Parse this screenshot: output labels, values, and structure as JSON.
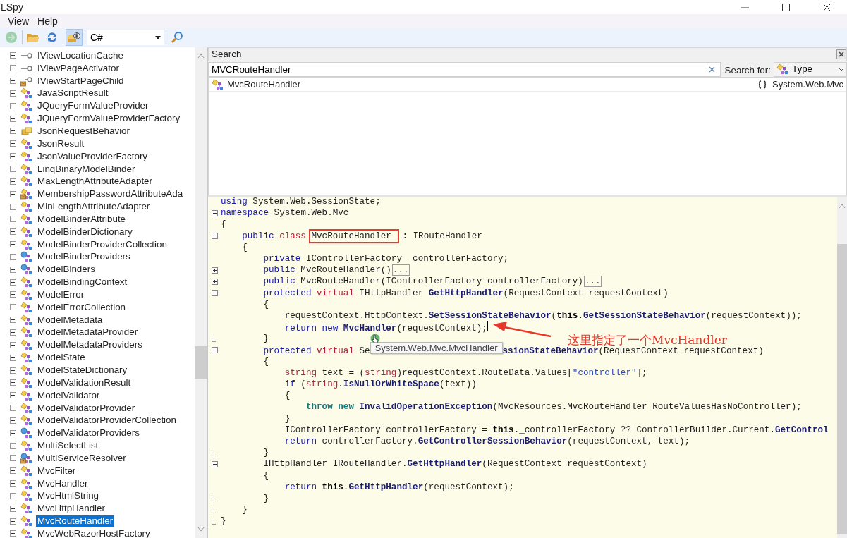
{
  "window": {
    "title": "LSpy"
  },
  "menu": [
    {
      "label": "View"
    },
    {
      "label": "Help"
    }
  ],
  "toolbar": {
    "back": {
      "disabled": true
    },
    "api_toggle": {
      "on": true
    },
    "language": "C#"
  },
  "tree": {
    "items": [
      {
        "label": "IViewLocationCache",
        "kind": "interface",
        "selected": false
      },
      {
        "label": "IViewPageActivator",
        "kind": "interface",
        "selected": false
      },
      {
        "label": "IViewStartPageChild",
        "kind": "interface-internal",
        "selected": false
      },
      {
        "label": "JavaScriptResult",
        "kind": "class",
        "selected": false
      },
      {
        "label": "JQueryFormValueProvider",
        "kind": "class",
        "selected": false
      },
      {
        "label": "JQueryFormValueProviderFactory",
        "kind": "class",
        "selected": false
      },
      {
        "label": "JsonRequestBehavior",
        "kind": "enum",
        "selected": false
      },
      {
        "label": "JsonResult",
        "kind": "class",
        "selected": false
      },
      {
        "label": "JsonValueProviderFactory",
        "kind": "class",
        "selected": false
      },
      {
        "label": "LinqBinaryModelBinder",
        "kind": "class",
        "selected": false
      },
      {
        "label": "MaxLengthAttributeAdapter",
        "kind": "class",
        "selected": false
      },
      {
        "label": "MembershipPasswordAttributeAda",
        "kind": "class-internal",
        "selected": false
      },
      {
        "label": "MinLengthAttributeAdapter",
        "kind": "class",
        "selected": false
      },
      {
        "label": "ModelBinderAttribute",
        "kind": "class",
        "selected": false
      },
      {
        "label": "ModelBinderDictionary",
        "kind": "class",
        "selected": false
      },
      {
        "label": "ModelBinderProviderCollection",
        "kind": "class",
        "selected": false
      },
      {
        "label": "ModelBinderProviders",
        "kind": "static-class",
        "selected": false
      },
      {
        "label": "ModelBinders",
        "kind": "static-class",
        "selected": false
      },
      {
        "label": "ModelBindingContext",
        "kind": "class",
        "selected": false
      },
      {
        "label": "ModelError",
        "kind": "class",
        "selected": false
      },
      {
        "label": "ModelErrorCollection",
        "kind": "class",
        "selected": false
      },
      {
        "label": "ModelMetadata",
        "kind": "class",
        "selected": false
      },
      {
        "label": "ModelMetadataProvider",
        "kind": "class",
        "selected": false
      },
      {
        "label": "ModelMetadataProviders",
        "kind": "class",
        "selected": false
      },
      {
        "label": "ModelState",
        "kind": "class",
        "selected": false
      },
      {
        "label": "ModelStateDictionary",
        "kind": "class",
        "selected": false
      },
      {
        "label": "ModelValidationResult",
        "kind": "class",
        "selected": false
      },
      {
        "label": "ModelValidator",
        "kind": "class",
        "selected": false
      },
      {
        "label": "ModelValidatorProvider",
        "kind": "class",
        "selected": false
      },
      {
        "label": "ModelValidatorProviderCollection",
        "kind": "class",
        "selected": false
      },
      {
        "label": "ModelValidatorProviders",
        "kind": "static-class",
        "selected": false
      },
      {
        "label": "MultiSelectList",
        "kind": "class",
        "selected": false
      },
      {
        "label": "MultiServiceResolver",
        "kind": "static-internal",
        "selected": false
      },
      {
        "label": "MvcFilter",
        "kind": "class",
        "selected": false
      },
      {
        "label": "MvcHandler",
        "kind": "class",
        "selected": false
      },
      {
        "label": "MvcHtmlString",
        "kind": "class",
        "selected": false
      },
      {
        "label": "MvcHttpHandler",
        "kind": "class",
        "selected": false
      },
      {
        "label": "MvcRouteHandler",
        "kind": "class",
        "selected": true
      },
      {
        "label": "MvcWebRazorHostFactory",
        "kind": "class",
        "selected": false
      }
    ]
  },
  "search": {
    "title": "Search",
    "query": "MVCRouteHandler",
    "search_for_label": "Search for:",
    "search_for": "Type",
    "results": [
      {
        "name": "MvcRouteHandler",
        "namespace": "System.Web.Mvc",
        "selected": false
      }
    ]
  },
  "code": {
    "lines": [
      {
        "kind": "plain",
        "tokens": [
          {
            "kind": "kw",
            "text": "using"
          },
          {
            "kind": "plain",
            "text": " System.Web.SessionState;"
          }
        ]
      },
      {
        "kind": "fold-open",
        "tokens": [
          {
            "kind": "kw",
            "text": "namespace"
          },
          {
            "kind": "plain",
            "text": " System.Web.Mvc"
          }
        ]
      },
      {
        "kind": "plain",
        "tokens": [
          {
            "kind": "plain",
            "text": "{"
          }
        ]
      },
      {
        "kind": "fold-open",
        "tokens": [
          {
            "kind": "kw",
            "text": "    public"
          },
          {
            "kind": "kw2",
            "text": " class "
          },
          {
            "kind": "boxed",
            "text": "MvcRouteHandler"
          },
          {
            "kind": "plain",
            "text": " : IRouteHandler"
          }
        ]
      },
      {
        "kind": "plain",
        "tokens": [
          {
            "kind": "plain",
            "text": "    {"
          }
        ]
      },
      {
        "kind": "plain",
        "tokens": [
          {
            "kind": "kw",
            "text": "        private"
          },
          {
            "kind": "plain",
            "text": " IControllerFactory _controllerFactory;"
          }
        ]
      },
      {
        "kind": "fold-closed",
        "tokens": [
          {
            "kind": "kw",
            "text": "        public"
          },
          {
            "kind": "plain",
            "text": " MvcRouteHandler()"
          },
          {
            "kind": "collapsed",
            "text": "..."
          }
        ]
      },
      {
        "kind": "fold-closed",
        "tokens": [
          {
            "kind": "kw",
            "text": "        public"
          },
          {
            "kind": "plain",
            "text": " MvcRouteHandler(IControllerFactory controllerFactory)"
          },
          {
            "kind": "collapsed",
            "text": "..."
          }
        ]
      },
      {
        "kind": "fold-open",
        "tokens": [
          {
            "kind": "kw",
            "text": "        protected"
          },
          {
            "kind": "kw2",
            "text": " virtual"
          },
          {
            "kind": "plain",
            "text": " IHttpHandler "
          },
          {
            "kind": "method",
            "text": "GetHttpHandler"
          },
          {
            "kind": "plain",
            "text": "(RequestContext requestContext)"
          }
        ]
      },
      {
        "kind": "plain",
        "tokens": [
          {
            "kind": "plain",
            "text": "        {"
          }
        ]
      },
      {
        "kind": "plain",
        "tokens": [
          {
            "kind": "plain",
            "text": "            requestContext.HttpContext."
          },
          {
            "kind": "method",
            "text": "SetSessionStateBehavior"
          },
          {
            "kind": "plain",
            "text": "("
          },
          {
            "kind": "this",
            "text": "this"
          },
          {
            "kind": "plain",
            "text": "."
          },
          {
            "kind": "method",
            "text": "GetSessionStateBehavior"
          },
          {
            "kind": "plain",
            "text": "(requestContext));"
          }
        ]
      },
      {
        "kind": "plain",
        "tokens": [
          {
            "kind": "kw",
            "text": "            return new"
          },
          {
            "kind": "method",
            "text": " MvcHandler"
          },
          {
            "kind": "plain",
            "text": "(requestContext);"
          },
          {
            "kind": "caret"
          }
        ]
      },
      {
        "kind": "fold-end",
        "tokens": [
          {
            "kind": "plain",
            "text": "        }"
          }
        ]
      },
      {
        "kind": "fold-open",
        "tokens": [
          {
            "kind": "kw",
            "text": "        protected"
          },
          {
            "kind": "kw2",
            "text": " virtual"
          },
          {
            "kind": "plain",
            "text": " Se"
          },
          {
            "kind": "tooltip",
            "text": "System.Web.Mvc.MvcHandler"
          },
          {
            "kind": "method",
            "text": "ssionStateBehavior"
          },
          {
            "kind": "plain",
            "text": "(RequestContext requestContext)"
          }
        ]
      },
      {
        "kind": "plain",
        "tokens": [
          {
            "kind": "plain",
            "text": "        {"
          }
        ]
      },
      {
        "kind": "plain",
        "tokens": [
          {
            "kind": "kw2",
            "text": "            string"
          },
          {
            "kind": "plain",
            "text": " text = ("
          },
          {
            "kind": "kw2",
            "text": "string"
          },
          {
            "kind": "plain",
            "text": ")requestContext.RouteData.Values["
          },
          {
            "kind": "str",
            "text": "\"controller\""
          },
          {
            "kind": "plain",
            "text": "];"
          }
        ]
      },
      {
        "kind": "plain",
        "tokens": [
          {
            "kind": "kw",
            "text": "            if"
          },
          {
            "kind": "plain",
            "text": " ("
          },
          {
            "kind": "kw2",
            "text": "string"
          },
          {
            "kind": "plain",
            "text": "."
          },
          {
            "kind": "method",
            "text": "IsNullOrWhiteSpace"
          },
          {
            "kind": "plain",
            "text": "(text))"
          }
        ]
      },
      {
        "kind": "plain",
        "tokens": [
          {
            "kind": "plain",
            "text": "            {"
          }
        ]
      },
      {
        "kind": "plain",
        "tokens": [
          {
            "kind": "flow",
            "text": "                throw new"
          },
          {
            "kind": "method",
            "text": " InvalidOperationException"
          },
          {
            "kind": "plain",
            "text": "(MvcResources.MvcRouteHandler_RouteValuesHasNoController);"
          }
        ]
      },
      {
        "kind": "plain",
        "tokens": [
          {
            "kind": "plain",
            "text": "            }"
          }
        ]
      },
      {
        "kind": "plain",
        "tokens": [
          {
            "kind": "plain",
            "text": "            IControllerFactory controllerFactory = "
          },
          {
            "kind": "this",
            "text": "this"
          },
          {
            "kind": "plain",
            "text": "._controllerFactory ?? ControllerBuilder.Current."
          },
          {
            "kind": "method",
            "text": "GetControl"
          }
        ]
      },
      {
        "kind": "plain",
        "tokens": [
          {
            "kind": "kw",
            "text": "            return"
          },
          {
            "kind": "plain",
            "text": " controllerFactory."
          },
          {
            "kind": "method",
            "text": "GetControllerSessionBehavior"
          },
          {
            "kind": "plain",
            "text": "(requestContext, text);"
          }
        ]
      },
      {
        "kind": "fold-end",
        "tokens": [
          {
            "kind": "plain",
            "text": "        }"
          }
        ]
      },
      {
        "kind": "fold-open",
        "tokens": [
          {
            "kind": "plain",
            "text": "        IHttpHandler IRouteHandler."
          },
          {
            "kind": "method",
            "text": "GetHttpHandler"
          },
          {
            "kind": "plain",
            "text": "(RequestContext requestContext)"
          }
        ]
      },
      {
        "kind": "plain",
        "tokens": [
          {
            "kind": "plain",
            "text": "        {"
          }
        ]
      },
      {
        "kind": "plain",
        "tokens": [
          {
            "kind": "kw",
            "text": "            return"
          },
          {
            "kind": "this",
            "text": " this"
          },
          {
            "kind": "plain",
            "text": "."
          },
          {
            "kind": "method",
            "text": "GetHttpHandler"
          },
          {
            "kind": "plain",
            "text": "(requestContext);"
          }
        ]
      },
      {
        "kind": "fold-end",
        "tokens": [
          {
            "kind": "plain",
            "text": "        }"
          }
        ]
      },
      {
        "kind": "fold-end",
        "tokens": [
          {
            "kind": "plain",
            "text": "    }"
          }
        ]
      },
      {
        "kind": "fold-end",
        "tokens": [
          {
            "kind": "plain",
            "text": "}"
          }
        ]
      }
    ],
    "annotation": {
      "text": "这里指定了一个MvcHandler"
    }
  }
}
